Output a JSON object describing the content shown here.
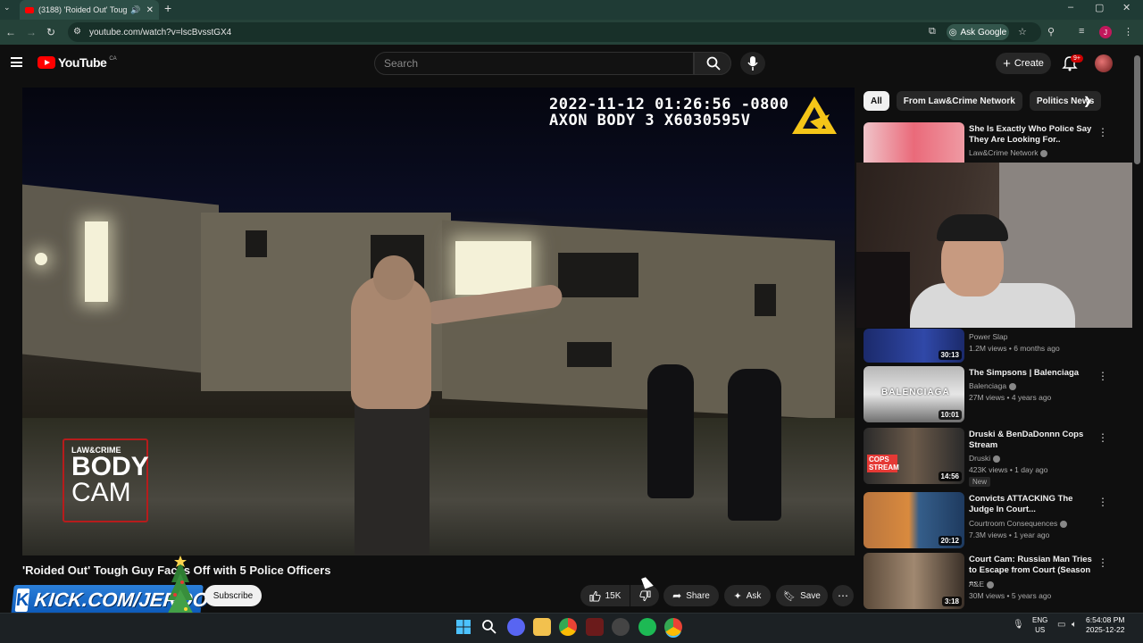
{
  "browser": {
    "tab_title": "(3188) 'Roided Out' Tough",
    "url": "youtube.com/watch?v=lscBvsstGX4",
    "ask_google": "Ask Google",
    "profile_initial": "J"
  },
  "youtube": {
    "logo_text": "YouTube",
    "region": "CA",
    "search_placeholder": "Search",
    "create_label": "Create",
    "notif_count": "9+"
  },
  "video": {
    "timestamp_line1": "2022-11-12 01:26:56 -0800",
    "timestamp_line2": "AXON BODY 3 X6030595V",
    "badge_brand": "LAW&CRIME",
    "badge_line1": "BODY",
    "badge_line2": "CAM",
    "title": "'Roided Out' Tough Guy Faces Off with 5 Police Officers",
    "subscribe_label": "Subscribe",
    "likes": "15K",
    "share_label": "Share",
    "ask_label": "Ask",
    "save_label": "Save",
    "overlay_banner": "KICK.COM/JERQO"
  },
  "sidebar": {
    "chips": [
      "All",
      "From Law&Crime Network",
      "Politics News"
    ],
    "recs": [
      {
        "title": "She Is Exactly Who Police Say They Are Looking For..",
        "channel": "Law&Crime Network",
        "meta": "",
        "duration": "",
        "new": false
      },
      {
        "title": "",
        "channel": "Power Slap",
        "meta": "1.2M views • 6 months ago",
        "duration": "30:13",
        "new": false
      },
      {
        "title": "The Simpsons | Balenciaga",
        "channel": "Balenciaga",
        "meta": "27M views • 4 years ago",
        "duration": "10:01",
        "new": false
      },
      {
        "title": "Druski & BenDaDonnn Cops Stream",
        "channel": "Druski",
        "meta": "423K views • 1 day ago",
        "duration": "14:56",
        "new": true
      },
      {
        "title": "Convicts ATTACKING The Judge In Court...",
        "channel": "Courtroom Consequences",
        "meta": "7.3M views • 1 year ago",
        "duration": "20:12",
        "new": false
      },
      {
        "title": "Court Cam: Russian Man Tries to Escape from Court (Season ...",
        "channel": "A&E",
        "meta": "30M views • 5 years ago",
        "duration": "3:18",
        "new": false
      }
    ],
    "new_badge": "New",
    "thumb_text_balenciaga": "BALENCIAGA",
    "thumb_text_cops": "COPS STREAM"
  },
  "taskbar": {
    "lang": "ENG",
    "region": "US",
    "time": "6:54:08 PM",
    "date": "2025-12-22"
  },
  "colors": {
    "youtube_red": "#ff0000",
    "background": "#0f0f0f",
    "chrome_green": "#254239",
    "kick_blue": "#0b58b8"
  }
}
